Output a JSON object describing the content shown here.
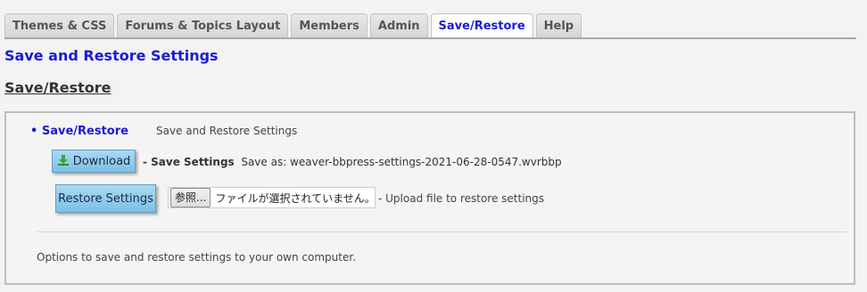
{
  "tabs": [
    {
      "label": "Themes & CSS",
      "active": false
    },
    {
      "label": "Forums & Topics Layout",
      "active": false
    },
    {
      "label": "Members",
      "active": false
    },
    {
      "label": "Admin",
      "active": false
    },
    {
      "label": "Save/Restore",
      "active": true
    },
    {
      "label": "Help",
      "active": false
    }
  ],
  "page_title": "Save and Restore Settings",
  "section_title": "Save/Restore",
  "panel": {
    "bullet_label": "• Save/Restore",
    "bullet_desc": "Save and Restore Settings",
    "download_button": "Download",
    "save_settings_label": "- Save Settings",
    "save_as_text": "Save as: weaver-bbpress-settings-2021-06-28-0547.wvrbbp",
    "restore_button": "Restore Settings",
    "file_browse_button": "参照...",
    "file_status": "ファイルが選択されていません。",
    "upload_desc": "- Upload file to restore settings",
    "options_text": "Options to save and restore settings to your own computer."
  },
  "colors": {
    "accent": "#1a1ad6",
    "button_bg": "#8ccbea"
  },
  "icons": {
    "download": "download-arrow-icon"
  }
}
